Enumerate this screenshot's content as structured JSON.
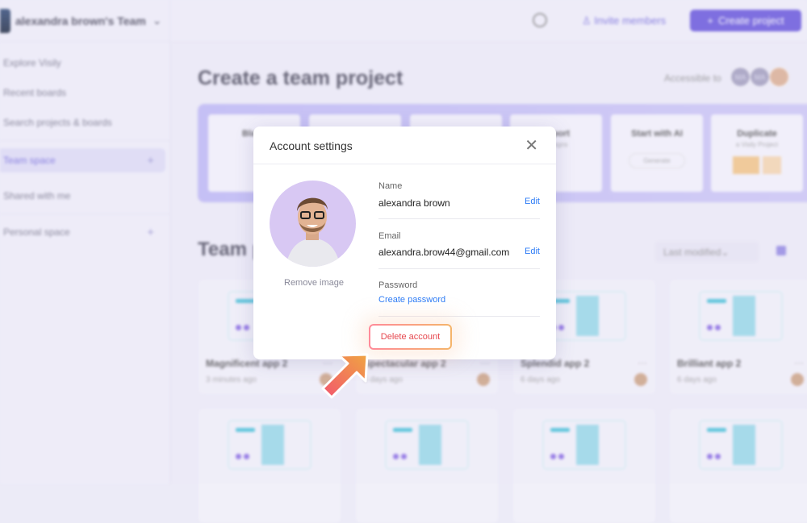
{
  "sidebar": {
    "team_name": "alexandra brown's Team",
    "items": [
      {
        "label": "Explore Visily"
      },
      {
        "label": "Recent boards"
      },
      {
        "label": "Search projects & boards"
      },
      {
        "label": "Team space"
      },
      {
        "label": "Shared with me"
      },
      {
        "label": "Personal space"
      }
    ]
  },
  "header": {
    "invite_label": "Invite members",
    "create_label": "Create project"
  },
  "main": {
    "title": "Create a team project",
    "accessible_label": "Accessible to",
    "avatars": [
      "MA",
      "MA"
    ],
    "templates": [
      {
        "title": "Blank",
        "sub": ""
      },
      {
        "title": "",
        "sub": ""
      },
      {
        "title": "",
        "sub": ""
      },
      {
        "title": "Import",
        "sub": "Designs"
      },
      {
        "title": "Start with AI",
        "sub": "Generate"
      },
      {
        "title": "Duplicate",
        "sub": "a Visily Project"
      }
    ],
    "projects_title": "Team projects",
    "sort_label": "Last modified",
    "projects": [
      {
        "name": "Magnificent app 2",
        "time": "3 minutes ago"
      },
      {
        "name": "Spectacular app 2",
        "time": "6 days ago"
      },
      {
        "name": "Splendid app 2",
        "time": "6 days ago"
      },
      {
        "name": "Brilliant app 2",
        "time": "6 days ago"
      }
    ]
  },
  "modal": {
    "title": "Account settings",
    "remove_image": "Remove image",
    "name_label": "Name",
    "name_value": "alexandra brown",
    "email_label": "Email",
    "email_value": "alexandra.brow44@gmail.com",
    "edit_label": "Edit",
    "password_label": "Password",
    "create_password": "Create password",
    "delete_account": "Delete account"
  },
  "colors": {
    "accent": "#5a47d8",
    "link": "#2f7df6",
    "danger": "#e6484f"
  }
}
